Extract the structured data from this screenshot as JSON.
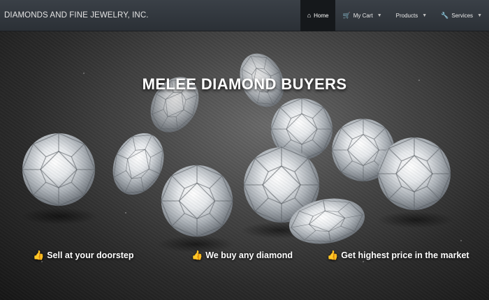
{
  "navbar": {
    "brand": "DIAMONDS AND FINE JEWELRY, INC.",
    "items": [
      {
        "label": "Home",
        "icon": "home-icon",
        "glyph": "⌂",
        "active": true,
        "dropdown": false
      },
      {
        "label": "My Cart",
        "icon": "cart-icon",
        "glyph": "🛒",
        "active": false,
        "dropdown": true
      },
      {
        "label": "Products",
        "icon": "",
        "glyph": "",
        "active": false,
        "dropdown": true
      },
      {
        "label": "Services",
        "icon": "wrench-icon",
        "glyph": "🔧",
        "active": false,
        "dropdown": true
      }
    ]
  },
  "hero": {
    "headline": "MELEE DIAMOND BUYERS",
    "features": [
      {
        "label": "Sell at your doorstep",
        "icon": "thumbs-up-icon"
      },
      {
        "label": "We buy any diamond",
        "icon": "thumbs-up-icon"
      },
      {
        "label": "Get highest price in the market",
        "icon": "thumbs-up-icon"
      }
    ]
  },
  "colors": {
    "navbar": "#2f343a",
    "active_tab": "#15181b",
    "text": "#ffffff"
  }
}
